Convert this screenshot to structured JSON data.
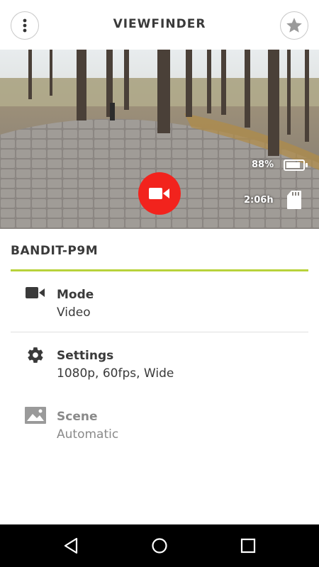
{
  "header": {
    "title": "VIEWFINDER",
    "menu_icon": "more-vert-icon",
    "favorite_icon": "star-icon"
  },
  "viewfinder": {
    "battery_percent": "88%",
    "battery_level": 0.88,
    "record_time_remaining": "2:06h",
    "record_icon": "videocam-icon",
    "record_color": "#f2231d"
  },
  "camera": {
    "name": "BANDIT-P9M",
    "accent_color": "#b8d23a"
  },
  "settings": {
    "mode": {
      "label": "Mode",
      "value": "Video",
      "icon": "videocam-icon"
    },
    "settings": {
      "label": "Settings",
      "value": "1080p, 60fps, Wide",
      "icon": "gear-icon"
    },
    "scene": {
      "label": "Scene",
      "value": "Automatic",
      "icon": "image-icon"
    }
  },
  "navbar": {
    "back_icon": "back-icon",
    "home_icon": "home-icon",
    "recents_icon": "recents-icon"
  }
}
